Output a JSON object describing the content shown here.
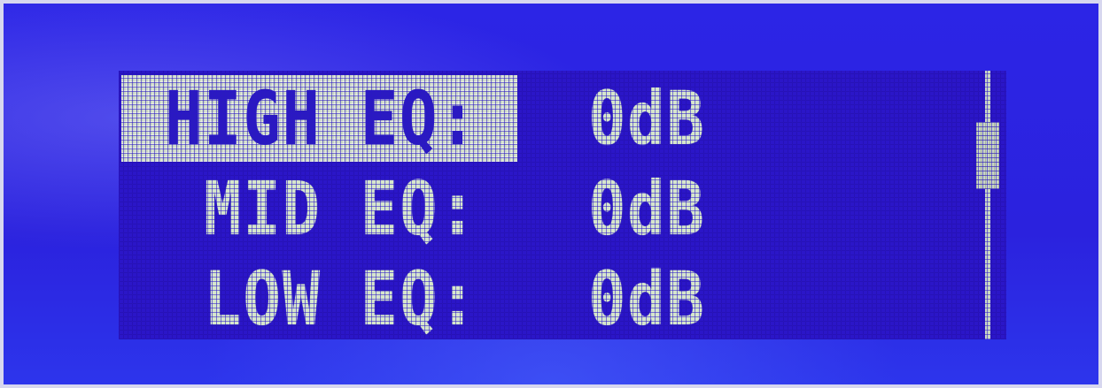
{
  "menu": {
    "items": [
      {
        "label": "HIGH EQ:",
        "value": "0dB",
        "selected": true
      },
      {
        "label": " MID EQ:",
        "value": "0dB",
        "selected": false
      },
      {
        "label": " LOW EQ:",
        "value": "0dB",
        "selected": false
      }
    ]
  },
  "scrollbar": {
    "position_fraction": 0.19,
    "thumb_fraction": 0.25
  },
  "colors": {
    "backlight": "#2b16c8",
    "pixel_on": "#d6e6cc",
    "highlight": "#c9d6c3"
  }
}
